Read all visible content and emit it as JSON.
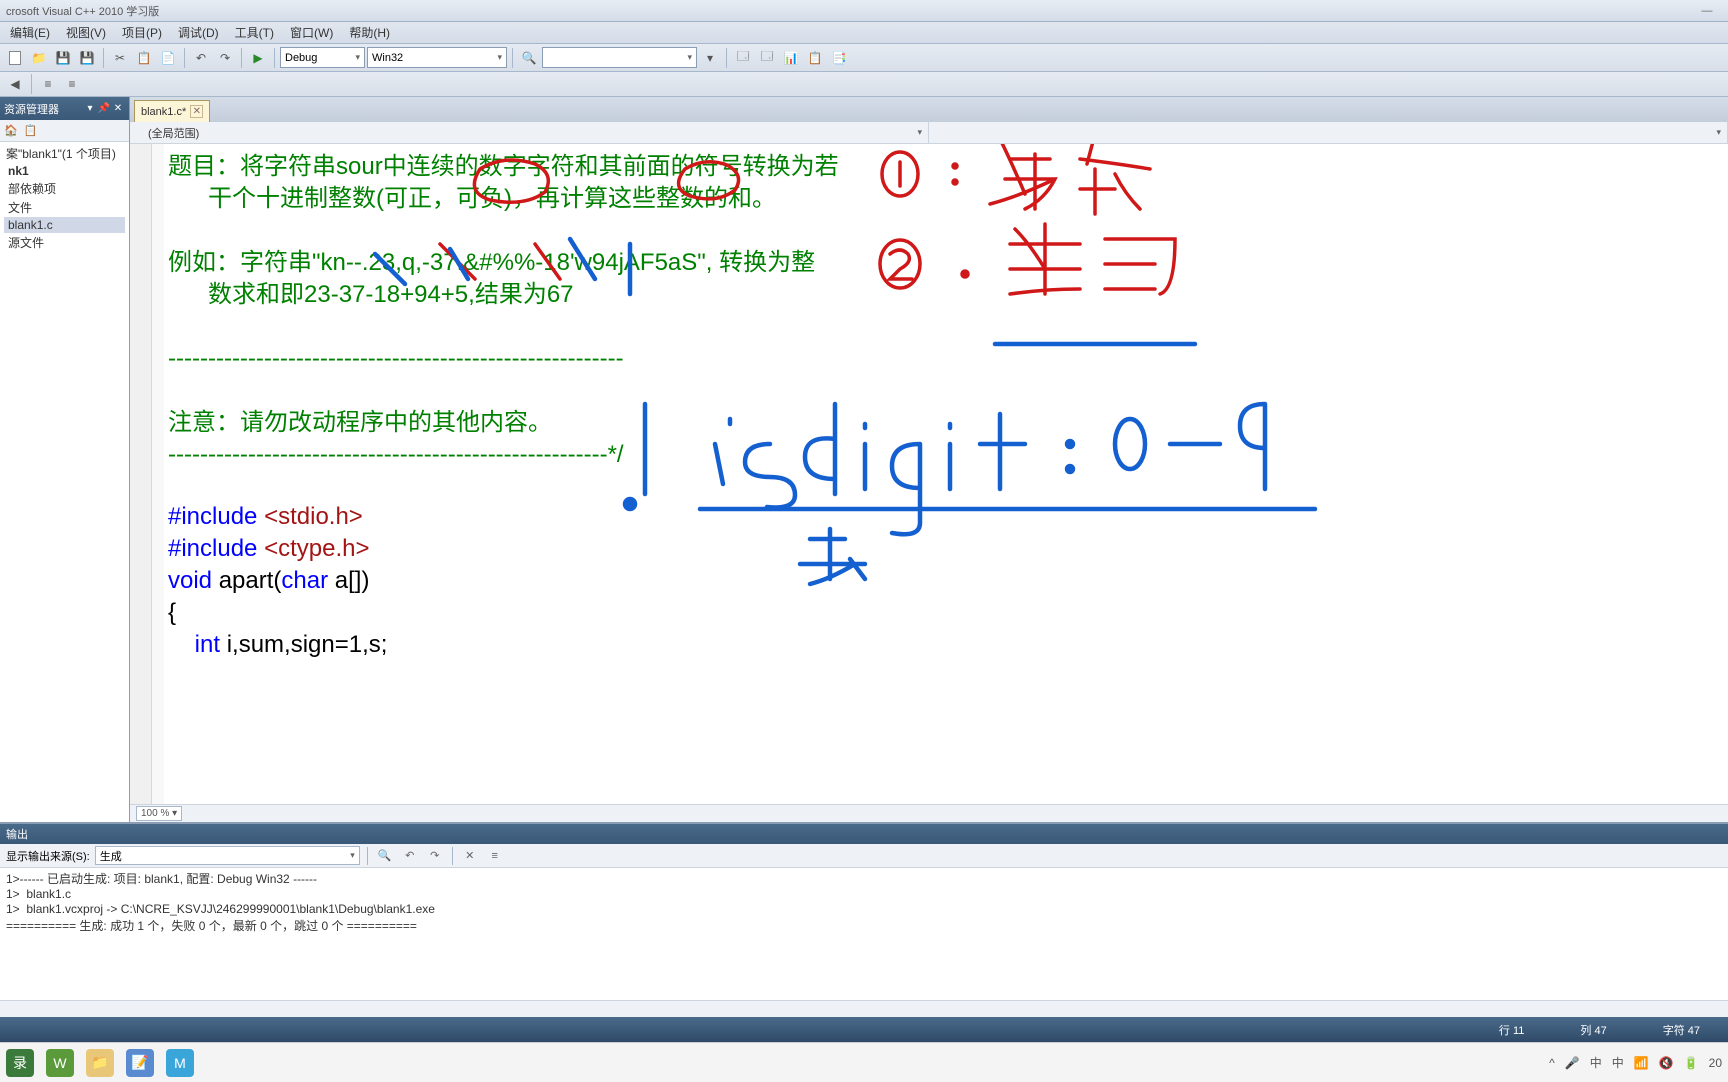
{
  "window": {
    "title": "crosoft Visual C++ 2010 学习版"
  },
  "menu": {
    "edit": "编辑(E)",
    "view": "视图(V)",
    "project": "项目(P)",
    "debug": "调试(D)",
    "tools": "工具(T)",
    "window": "窗口(W)",
    "help": "帮助(H)"
  },
  "toolbar": {
    "config": "Debug",
    "platform": "Win32",
    "find_placeholder": ""
  },
  "solution_explorer": {
    "title": "资源管理器",
    "solution": "案\"blank1\"(1 个项目)",
    "project": "nk1",
    "ext_deps": "部依赖项",
    "header": "文件",
    "source_item": "blank1.c",
    "source_folder": "源文件"
  },
  "tab": {
    "name": "blank1.c*"
  },
  "scope": {
    "global": "(全局范围)"
  },
  "code": {
    "c1": "题目：将字符串sour中连续的数字字符和其前面的符号转换为若",
    "c2": "      干个十进制整数(可正，可负)，再计算这些整数的和。",
    "c3": "",
    "c4": "例如：字符串\"kn--.23,q,-37.&#%%-18'w94jAF5aS\", 转换为整",
    "c5": "      数求和即23-37-18+94+5,结果为67",
    "c6": "",
    "sep1": "---------------------------------------------------------",
    "c7": "",
    "c8": "注意：请勿改动程序中的其他内容。",
    "sep2": "-------------------------------------------------------*/",
    "inc1a": "#include ",
    "inc1b": "<stdio.h>",
    "inc2a": "#include ",
    "inc2b": "<ctype.h>",
    "fn1a": "void",
    "fn1b": " apart(",
    "fn1c": "char",
    "fn1d": " a[])",
    "brace": "{",
    "var1a": "    int",
    "var1b": " i,sum,sign=1,s;"
  },
  "zoom": "100 %",
  "output": {
    "title": "输出",
    "source_label": "显示输出来源(S):",
    "source_value": "生成",
    "line1": "1>------ 已启动生成: 项目: blank1, 配置: Debug Win32 ------",
    "line2": "1>  blank1.c",
    "line3": "1>  blank1.vcxproj -> C:\\NCRE_KSVJJ\\246299990001\\blank1\\Debug\\blank1.exe",
    "line4": "========== 生成: 成功 1 个，失败 0 个，最新 0 个，跳过 0 个 =========="
  },
  "status": {
    "line": "行 11",
    "col": "列 47",
    "char": "字符 47",
    "end": "20"
  },
  "systray": {
    "ime1": "中",
    "ime2": "中"
  }
}
